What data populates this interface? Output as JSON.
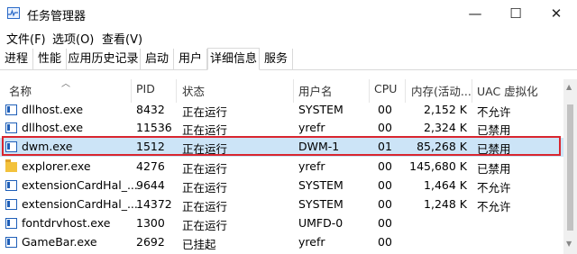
{
  "window": {
    "title": "任务管理器",
    "controls": {
      "minimize": "—",
      "maximize": "☐",
      "close": "✕"
    }
  },
  "menu": [
    "文件(F)",
    "选项(O)",
    "查看(V)"
  ],
  "tabs": [
    {
      "label": "进程",
      "active": false
    },
    {
      "label": "性能",
      "active": false
    },
    {
      "label": "应用历史记录",
      "active": false
    },
    {
      "label": "启动",
      "active": false
    },
    {
      "label": "用户",
      "active": false
    },
    {
      "label": "详细信息",
      "active": true
    },
    {
      "label": "服务",
      "active": false
    }
  ],
  "columns": {
    "name": "名称",
    "pid": "PID",
    "status": "状态",
    "user": "用户名",
    "cpu": "CPU",
    "memory": "内存(活动...",
    "uac": "UAC 虚拟化"
  },
  "processes": [
    {
      "icon": "app-window-icon",
      "name": "dllhost.exe",
      "pid": "8432",
      "status": "正在运行",
      "user": "SYSTEM",
      "cpu": "00",
      "memory": "2,152 K",
      "uac": "不允许"
    },
    {
      "icon": "app-window-icon",
      "name": "dllhost.exe",
      "pid": "11536",
      "status": "正在运行",
      "user": "yrefr",
      "cpu": "00",
      "memory": "2,324 K",
      "uac": "已禁用"
    },
    {
      "icon": "app-window-icon",
      "name": "dwm.exe",
      "pid": "1512",
      "status": "正在运行",
      "user": "DWM-1",
      "cpu": "01",
      "memory": "85,268 K",
      "uac": "已禁用",
      "selected": true
    },
    {
      "icon": "folder-icon",
      "name": "explorer.exe",
      "pid": "4276",
      "status": "正在运行",
      "user": "yrefr",
      "cpu": "00",
      "memory": "145,680 K",
      "uac": "已禁用"
    },
    {
      "icon": "app-window-icon",
      "name": "extensionCardHal_...",
      "pid": "9644",
      "status": "正在运行",
      "user": "SYSTEM",
      "cpu": "00",
      "memory": "1,464 K",
      "uac": "不允许"
    },
    {
      "icon": "app-window-icon",
      "name": "extensionCardHal_...",
      "pid": "14372",
      "status": "正在运行",
      "user": "SYSTEM",
      "cpu": "00",
      "memory": "1,248 K",
      "uac": "不允许"
    },
    {
      "icon": "app-window-icon",
      "name": "fontdrvhost.exe",
      "pid": "1300",
      "status": "正在运行",
      "user": "UMFD-0",
      "cpu": "00",
      "memory": "",
      "uac": ""
    },
    {
      "icon": "app-window-icon",
      "name": "GameBar.exe",
      "pid": "2692",
      "status": "已挂起",
      "user": "yrefr",
      "cpu": "00",
      "memory": "",
      "uac": ""
    }
  ],
  "colors": {
    "selected_row": "#cce4f7",
    "highlight_border": "#d9262f"
  }
}
